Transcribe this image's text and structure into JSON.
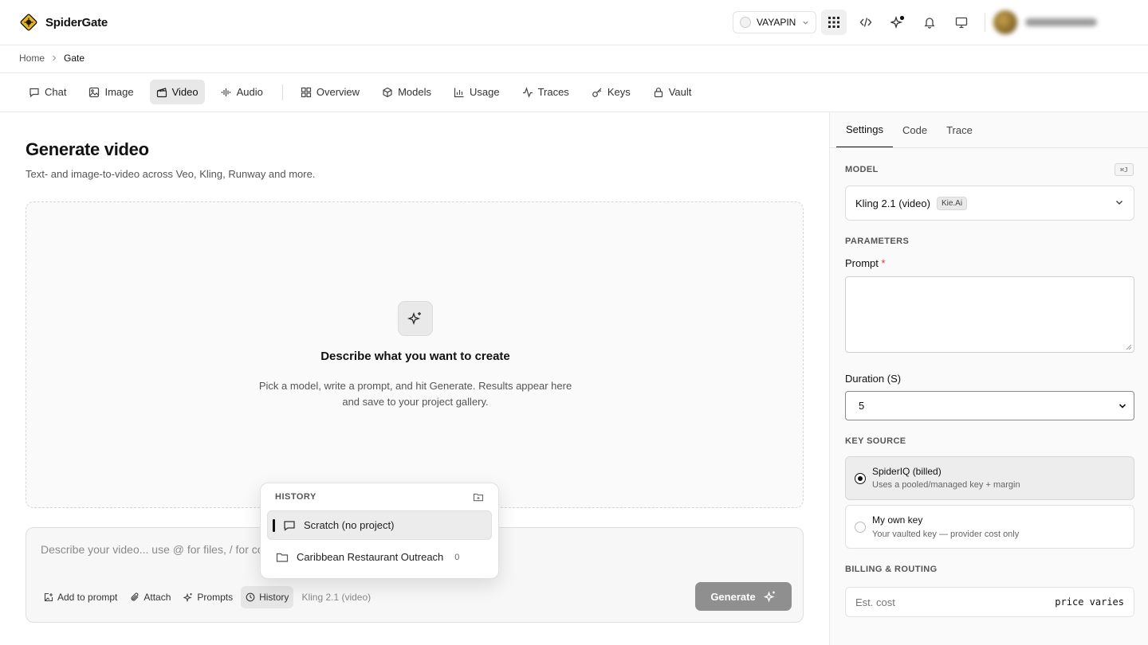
{
  "app": {
    "name": "SpiderGate"
  },
  "header": {
    "org_name": "VAYAPIN"
  },
  "breadcrumb": [
    "Home",
    "Gate"
  ],
  "tabs": {
    "chat": "Chat",
    "image": "Image",
    "video": "Video",
    "audio": "Audio",
    "overview": "Overview",
    "models": "Models",
    "usage": "Usage",
    "traces": "Traces",
    "keys": "Keys",
    "vault": "Vault"
  },
  "main": {
    "title": "Generate video",
    "subtitle": "Text- and image-to-video across Veo, Kling, Runway and more.",
    "empty_title": "Describe what you want to create",
    "empty_desc": "Pick a model, write a prompt, and hit Generate. Results appear here and save to your project gallery."
  },
  "composer": {
    "placeholder": "Describe your video... use @ for files, / for commands",
    "add_to_prompt": "Add to prompt",
    "attach": "Attach",
    "prompts": "Prompts",
    "history": "History",
    "model": "Kling 2.1 (video)",
    "generate": "Generate"
  },
  "history_popup": {
    "heading": "HISTORY",
    "items": [
      {
        "label": "Scratch (no project)"
      },
      {
        "label": "Caribbean Restaurant Outreach",
        "count": "0"
      }
    ]
  },
  "side": {
    "tabs": [
      "Settings",
      "Code",
      "Trace"
    ],
    "model_heading": "MODEL",
    "shortcut": "⌘J",
    "model_name": "Kling 2.1 (video)",
    "model_provider": "Kie.Ai",
    "params_heading": "PARAMETERS",
    "prompt_label": "Prompt",
    "required_mark": "*",
    "duration_label": "Duration (S)",
    "duration_value": "5",
    "key_source_heading": "KEY SOURCE",
    "key_options": [
      {
        "title": "SpiderIQ (billed)",
        "desc": "Uses a pooled/managed key + margin"
      },
      {
        "title": "My own key",
        "desc": "Your vaulted key — provider cost only"
      }
    ],
    "billing_heading": "BILLING & ROUTING",
    "cost_label": "Est. cost",
    "cost_value": "price varies"
  }
}
